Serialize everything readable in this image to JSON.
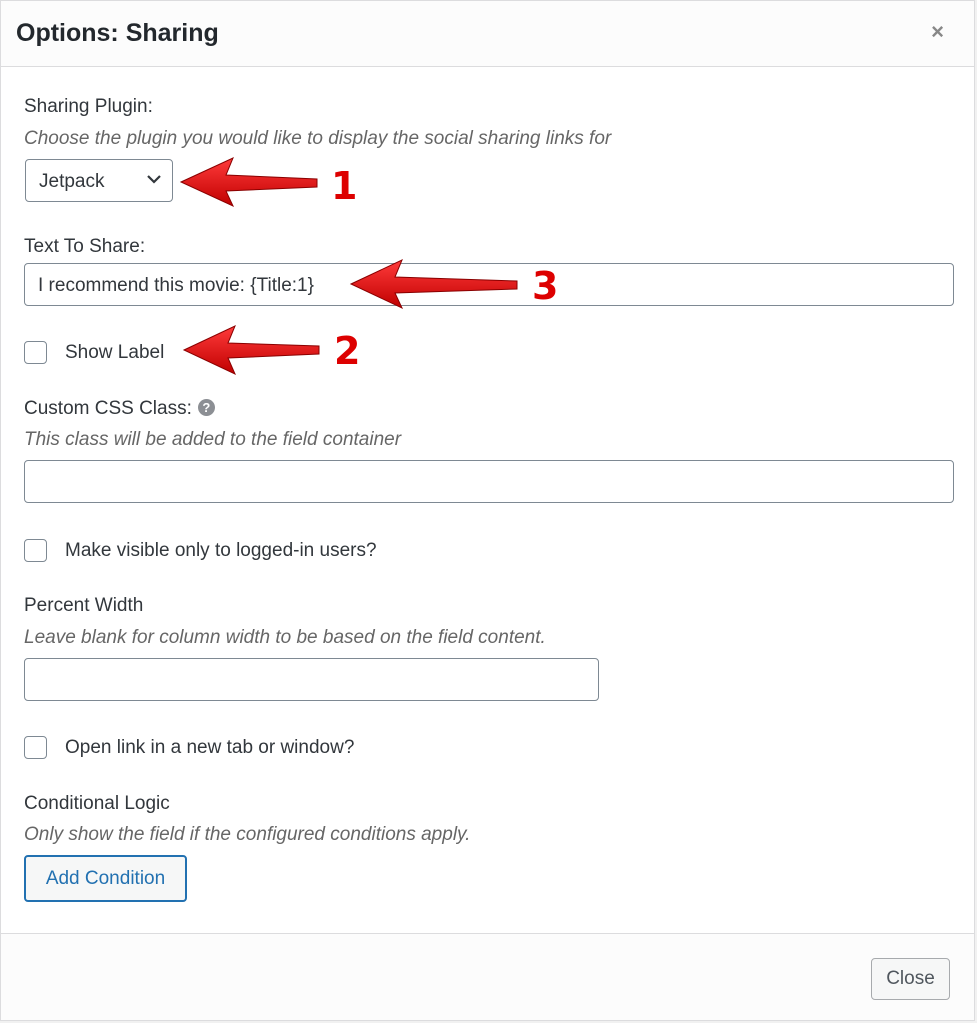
{
  "dialog": {
    "title": "Options: Sharing",
    "close_icon": "×"
  },
  "sharing_plugin": {
    "label": "Sharing Plugin:",
    "description": "Choose the plugin you would like to display the social sharing links for",
    "selected": "Jetpack"
  },
  "text_to_share": {
    "label": "Text To Share:",
    "value": "I recommend this movie: {Title:1}"
  },
  "show_label": {
    "label": "Show Label",
    "checked": false
  },
  "custom_css": {
    "label": "Custom CSS Class:",
    "help_icon": "?",
    "description": "This class will be added to the field container",
    "value": ""
  },
  "logged_in": {
    "label": "Make visible only to logged-in users?",
    "checked": false
  },
  "percent_width": {
    "label": "Percent Width",
    "description": "Leave blank for column width to be based on the field content.",
    "value": ""
  },
  "new_tab": {
    "label": "Open link in a new tab or window?",
    "checked": false
  },
  "conditional_logic": {
    "label": "Conditional Logic",
    "description": "Only show the field if the configured conditions apply.",
    "button": "Add Condition"
  },
  "footer": {
    "close_button": "Close"
  },
  "annotations": {
    "arrow_color": "#dd0000",
    "items": [
      {
        "number": "1"
      },
      {
        "number": "2"
      },
      {
        "number": "3"
      }
    ]
  }
}
